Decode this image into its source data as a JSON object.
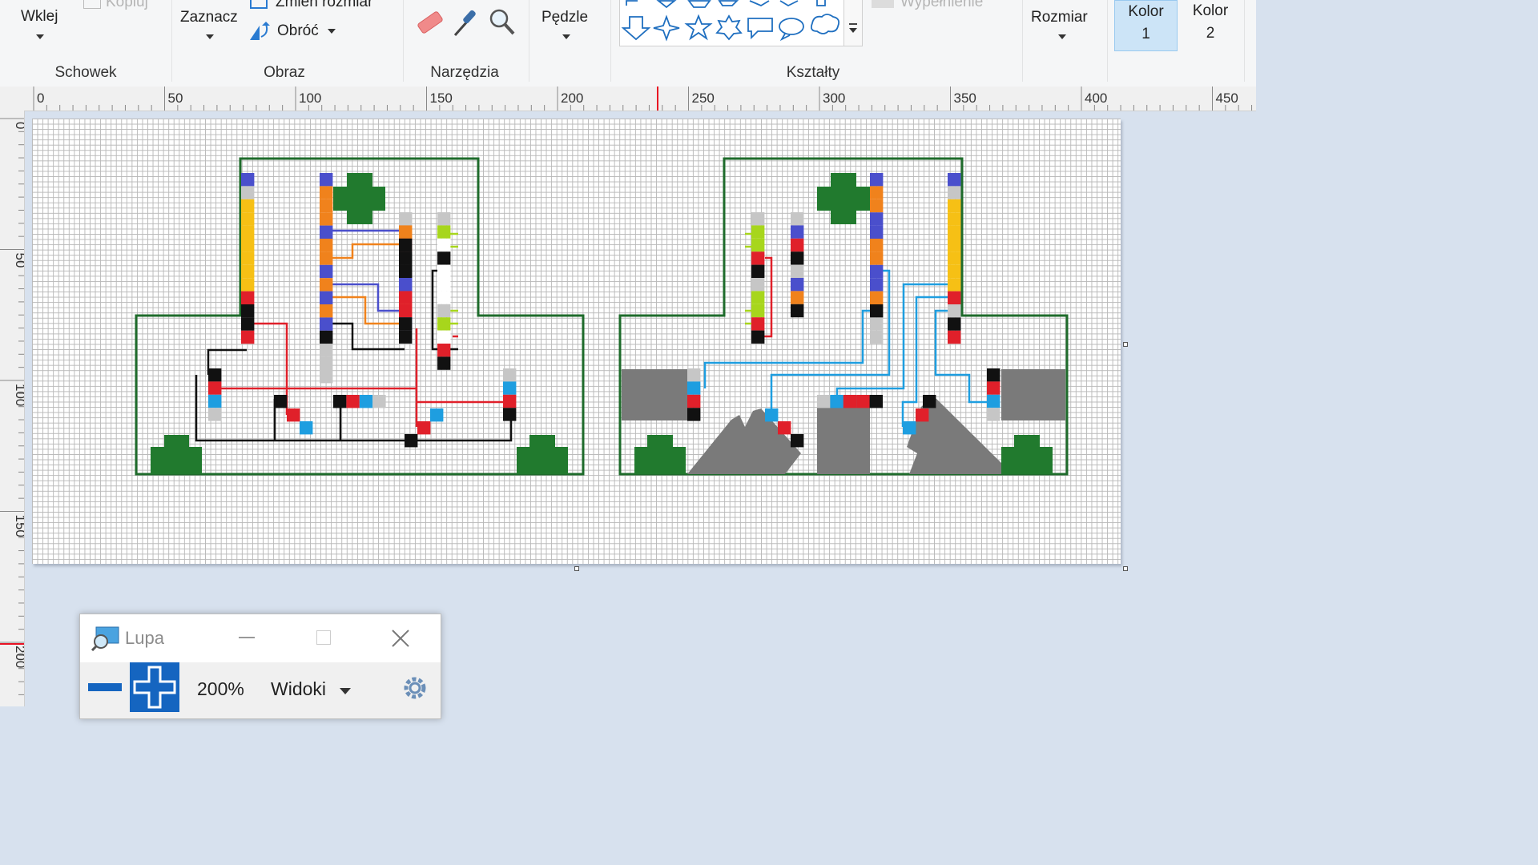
{
  "ribbon": {
    "wklej": "Wklej",
    "kopiuj": "Kopiuj",
    "zaznacz": "Zaznacz",
    "zmien_rozmiar": "Zmień rozmiar",
    "obroc": "Obróć",
    "pedzle": "Pędzle",
    "wypelnienie": "Wypełnienie",
    "rozmiar": "Rozmiar",
    "kolor1_label": "Kolor",
    "kolor1_num": "1",
    "kolor2_label": "Kolor",
    "kolor2_num": "2",
    "groups": {
      "schowek": "Schowek",
      "obraz": "Obraz",
      "narzedzia": "Narzędzia",
      "ksztalty": "Kształty"
    }
  },
  "ruler": {
    "h_ticks": [
      "0",
      "50",
      "100",
      "150",
      "200",
      "250",
      "300",
      "350",
      "400",
      "450"
    ],
    "v_ticks": [
      "0",
      "50",
      "100",
      "150",
      "200"
    ]
  },
  "colors": {
    "outline_green": "#1e6b2b",
    "bush_green": "#217a2e",
    "blue": "#4a4fcc",
    "orange": "#f0821c",
    "yellow": "#f6c015",
    "red": "#e0202a",
    "black": "#111111",
    "gray": "#c6c6c6",
    "lime": "#a7d61c",
    "sky": "#1e9ee0",
    "rock": "#7a7a7a"
  },
  "magnifier": {
    "title": "Lupa",
    "zoom": "200%",
    "views": "Widoki"
  }
}
